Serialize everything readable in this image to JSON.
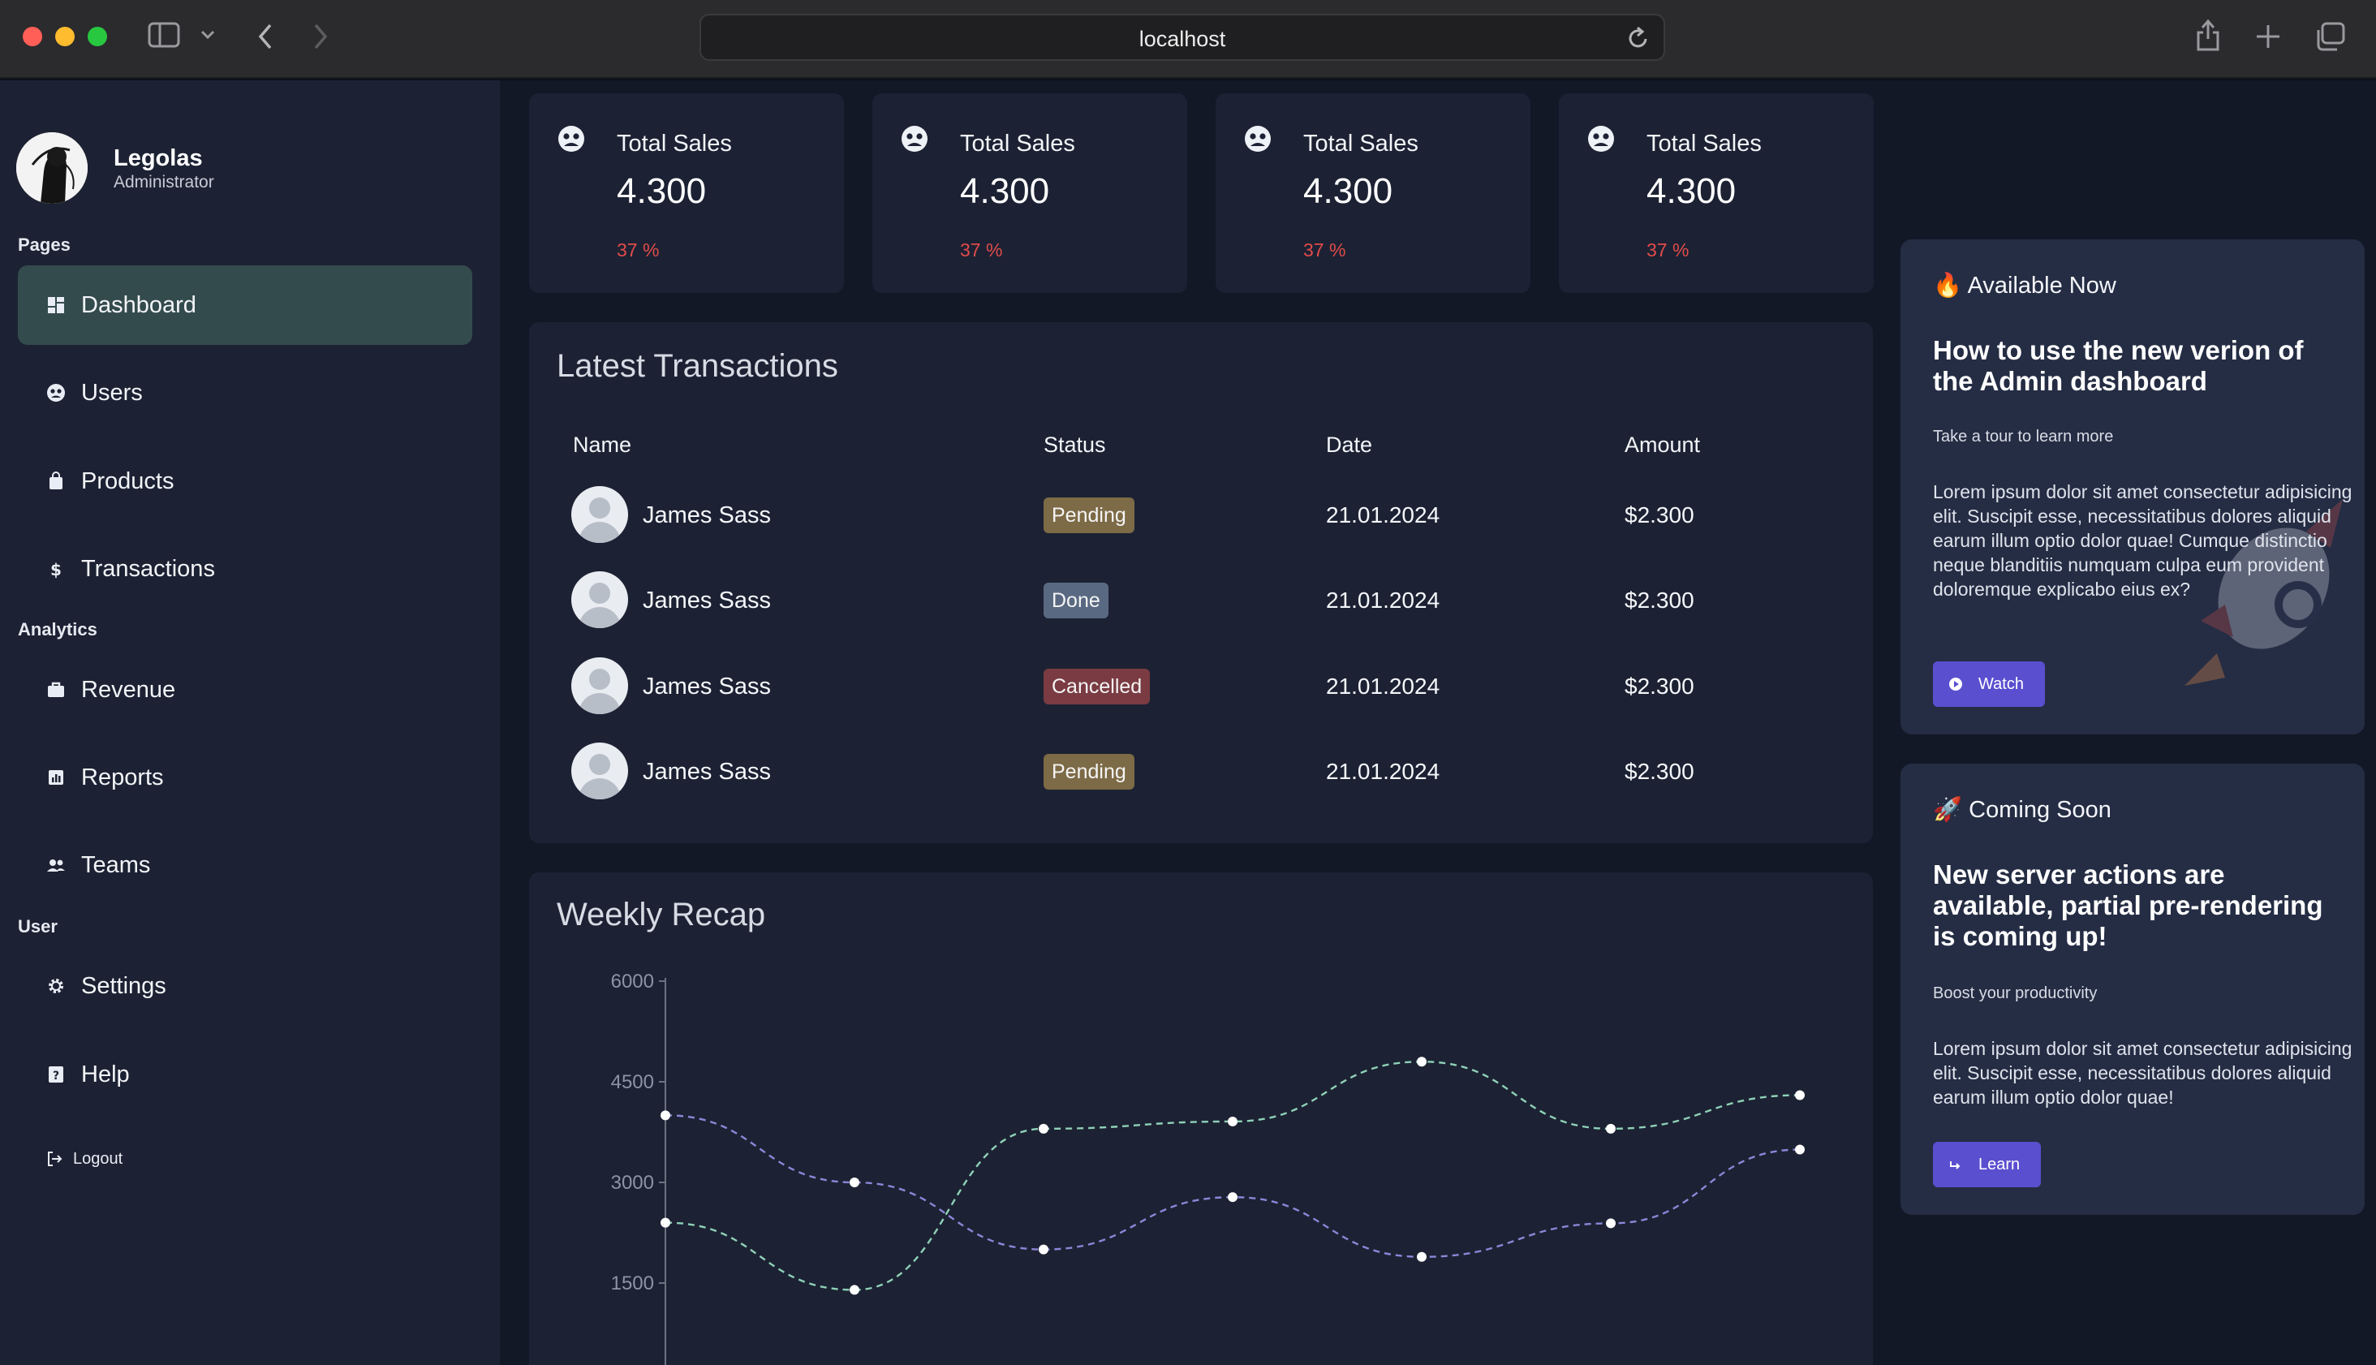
{
  "browser": {
    "address": "localhost",
    "icons": [
      "sidebar-toggle-icon",
      "chevron-down-icon",
      "back-icon",
      "forward-icon",
      "reload-icon",
      "share-icon",
      "new-tab-icon",
      "tabs-overview-icon"
    ]
  },
  "sidebar": {
    "profile": {
      "name": "Legolas",
      "role": "Administrator"
    },
    "sections": {
      "pages": "Pages",
      "analytics": "Analytics",
      "user": "User"
    },
    "items": [
      {
        "label": "Dashboard",
        "icon": "dashboard-icon",
        "active": true
      },
      {
        "label": "Users",
        "icon": "users-icon"
      },
      {
        "label": "Products",
        "icon": "bag-icon"
      },
      {
        "label": "Transactions",
        "icon": "dollar-icon"
      },
      {
        "label": "Revenue",
        "icon": "briefcase-icon"
      },
      {
        "label": "Reports",
        "icon": "report-icon"
      },
      {
        "label": "Teams",
        "icon": "teams-icon"
      },
      {
        "label": "Settings",
        "icon": "gear-icon"
      },
      {
        "label": "Help",
        "icon": "help-icon"
      }
    ],
    "logout": "Logout"
  },
  "stats": [
    {
      "title": "Total Sales",
      "value": "4.300",
      "change": "37 %"
    },
    {
      "title": "Total Sales",
      "value": "4.300",
      "change": "37 %"
    },
    {
      "title": "Total Sales",
      "value": "4.300",
      "change": "37 %"
    },
    {
      "title": "Total Sales",
      "value": "4.300",
      "change": "37 %"
    }
  ],
  "transactions": {
    "title": "Latest Transactions",
    "columns": [
      "Name",
      "Status",
      "Date",
      "Amount"
    ],
    "rows": [
      {
        "name": "James Sass",
        "status": "Pending",
        "date": "21.01.2024",
        "amount": "$2.300"
      },
      {
        "name": "James Sass",
        "status": "Done",
        "date": "21.01.2024",
        "amount": "$2.300"
      },
      {
        "name": "James Sass",
        "status": "Cancelled",
        "date": "21.01.2024",
        "amount": "$2.300"
      },
      {
        "name": "James Sass",
        "status": "Pending",
        "date": "21.01.2024",
        "amount": "$2.300"
      }
    ],
    "status_colors": {
      "Pending": "#7d6a46",
      "Done": "#596982",
      "Cancelled": "#7a3b42"
    }
  },
  "chart_data": {
    "title": "Weekly Recap",
    "type": "line",
    "x": [
      1,
      2,
      3,
      4,
      5,
      6,
      7
    ],
    "series": [
      {
        "values": [
          4000,
          3000,
          2000,
          2780,
          1890,
          2390,
          3490
        ],
        "color": "#8c86d9"
      },
      {
        "values": [
          2400,
          1398,
          3800,
          3908,
          4800,
          3800,
          4300
        ],
        "color": "#8fd1b7"
      }
    ],
    "yticks": [
      6000,
      4500,
      3000,
      1500
    ],
    "ylim": [
      0,
      6000
    ],
    "grid": false,
    "line_style": "dashed"
  },
  "cards": {
    "available": {
      "emoji": "🔥",
      "heading": "Available Now",
      "title": "How to use the new verion of the Admin dashboard",
      "subtitle": "Take a tour to learn more",
      "body": "Lorem ipsum dolor sit amet consectetur adipisicing elit. Suscipit esse, necessitatibus dolores aliquid earum illum optio dolor quae! Cumque distinctio neque blanditiis numquam culpa eum provident doloremque explicabo eius ex?",
      "button": "Watch"
    },
    "coming": {
      "emoji": "🚀",
      "heading": "Coming Soon",
      "title": "New server actions are available, partial pre-rendering is coming up!",
      "subtitle": "Boost your productivity",
      "body": "Lorem ipsum dolor sit amet consectetur adipisicing elit. Suscipit esse, necessitatibus dolores aliquid earum illum optio dolor quae!",
      "button": "Learn"
    }
  }
}
